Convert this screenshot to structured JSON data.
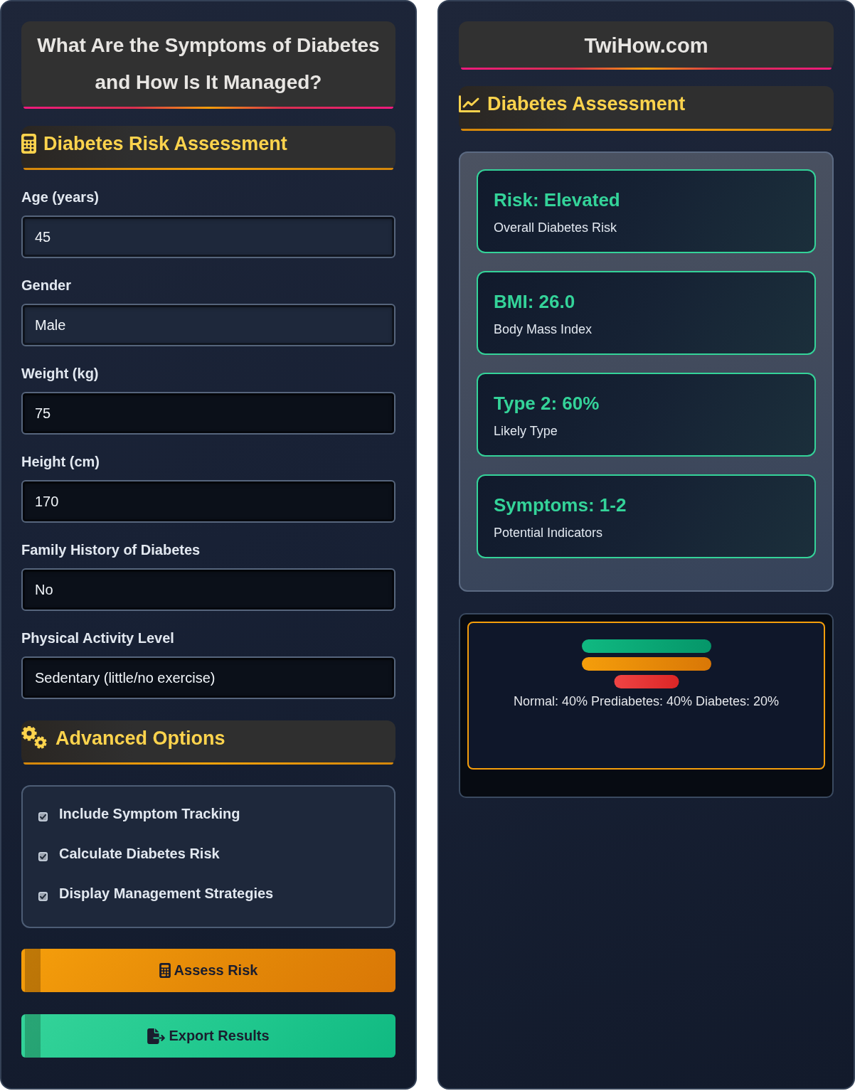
{
  "left_panel": {
    "title": "What Are the Symptoms of Diabetes and How Is It Managed?",
    "form_header": "Diabetes Risk Assessment",
    "fields": [
      {
        "label": "Age (years)",
        "value": "45",
        "kind": "light"
      },
      {
        "label": "Gender",
        "value": "Male",
        "kind": "light"
      },
      {
        "label": "Weight (kg)",
        "value": "75",
        "kind": "dark"
      },
      {
        "label": "Height (cm)",
        "value": "170",
        "kind": "dark"
      },
      {
        "label": "Family History of Diabetes",
        "value": "No",
        "kind": "dark"
      },
      {
        "label": "Physical Activity Level",
        "value": "Sedentary (little/no exercise)",
        "kind": "dark"
      }
    ],
    "advanced_header": "Advanced Options",
    "options": [
      {
        "label": "Include Symptom Tracking",
        "checked": true
      },
      {
        "label": "Calculate Diabetes Risk",
        "checked": true
      },
      {
        "label": "Display Management Strategies",
        "checked": true
      }
    ],
    "buttons": [
      {
        "label": "Assess Risk",
        "kind": "calculate"
      },
      {
        "label": "Export Results",
        "kind": "export"
      }
    ]
  },
  "right_panel": {
    "site_title": "TwiHow.com",
    "results_header": "Diabetes Assessment",
    "results": [
      {
        "value": "Risk: Elevated",
        "label": "Overall Diabetes Risk"
      },
      {
        "value": "BMI: 26.0",
        "label": "Body Mass Index"
      },
      {
        "value": "Type 2: 60%",
        "label": "Likely Type"
      },
      {
        "value": "Symptoms: 1-2",
        "label": "Potential Indicators"
      }
    ],
    "distribution": {
      "legend": "Normal: 40% Prediabetes: 40% Diabetes: 20%"
    }
  }
}
